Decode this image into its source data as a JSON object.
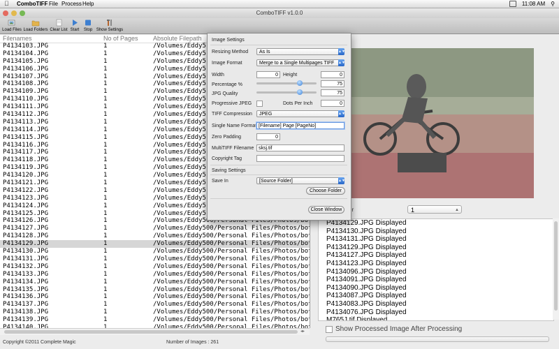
{
  "menubar": {
    "app_name": "ComboTIFF",
    "menus": [
      "File",
      "Process",
      "Help"
    ],
    "clock": "11:08 AM"
  },
  "window": {
    "title": "ComboTIFF v1.0.0"
  },
  "toolbar": {
    "load_files": "Load Files",
    "load_folders": "Load Folders",
    "clear_list": "Clear List",
    "start": "Start",
    "stop": "Stop",
    "show_settings": "Show Settings"
  },
  "table": {
    "headers": [
      "Filenames",
      "No of Pages",
      "Absolute Filepath"
    ],
    "rows": [
      [
        "P4134103.JPG",
        "1",
        "/Volumes/Eddy5"
      ],
      [
        "P4134104.JPG",
        "1",
        "/Volumes/Eddy5"
      ],
      [
        "P4134105.JPG",
        "1",
        "/Volumes/Eddy5"
      ],
      [
        "P4134106.JPG",
        "1",
        "/Volumes/Eddy5"
      ],
      [
        "P4134107.JPG",
        "1",
        "/Volumes/Eddy5"
      ],
      [
        "P4134108.JPG",
        "1",
        "/Volumes/Eddy5"
      ],
      [
        "P4134109.JPG",
        "1",
        "/Volumes/Eddy5"
      ],
      [
        "P4134110.JPG",
        "1",
        "/Volumes/Eddy5"
      ],
      [
        "P4134111.JPG",
        "1",
        "/Volumes/Eddy5"
      ],
      [
        "P4134112.JPG",
        "1",
        "/Volumes/Eddy5"
      ],
      [
        "P4134113.JPG",
        "1",
        "/Volumes/Eddy5"
      ],
      [
        "P4134114.JPG",
        "1",
        "/Volumes/Eddy5"
      ],
      [
        "P4134115.JPG",
        "1",
        "/Volumes/Eddy5"
      ],
      [
        "P4134116.JPG",
        "1",
        "/Volumes/Eddy5"
      ],
      [
        "P4134117.JPG",
        "1",
        "/Volumes/Eddy5"
      ],
      [
        "P4134118.JPG",
        "1",
        "/Volumes/Eddy5"
      ],
      [
        "P4134119.JPG",
        "1",
        "/Volumes/Eddy5"
      ],
      [
        "P4134120.JPG",
        "1",
        "/Volumes/Eddy5"
      ],
      [
        "P4134121.JPG",
        "1",
        "/Volumes/Eddy5"
      ],
      [
        "P4134122.JPG",
        "1",
        "/Volumes/Eddy5"
      ],
      [
        "P4134123.JPG",
        "1",
        "/Volumes/Eddy5"
      ],
      [
        "P4134124.JPG",
        "1",
        "/Volumes/Eddy5"
      ],
      [
        "P4134125.JPG",
        "1",
        "/Volumes/Eddy5"
      ],
      [
        "P4134126.JPG",
        "1",
        "/Volumes/Eddy500/Personal Files/Photos/botar"
      ],
      [
        "P4134127.JPG",
        "1",
        "/Volumes/Eddy500/Personal Files/Photos/botar"
      ],
      [
        "P4134128.JPG",
        "1",
        "/Volumes/Eddy500/Personal Files/Photos/botar"
      ],
      [
        "P4134129.JPG",
        "1",
        "/Volumes/Eddy500/Personal Files/Photos/botar"
      ],
      [
        "P4134130.JPG",
        "1",
        "/Volumes/Eddy500/Personal Files/Photos/botar"
      ],
      [
        "P4134131.JPG",
        "1",
        "/Volumes/Eddy500/Personal Files/Photos/botar"
      ],
      [
        "P4134132.JPG",
        "1",
        "/Volumes/Eddy500/Personal Files/Photos/botar"
      ],
      [
        "P4134133.JPG",
        "1",
        "/Volumes/Eddy500/Personal Files/Photos/botar"
      ],
      [
        "P4134134.JPG",
        "1",
        "/Volumes/Eddy500/Personal Files/Photos/botar"
      ],
      [
        "P4134135.JPG",
        "1",
        "/Volumes/Eddy500/Personal Files/Photos/botar"
      ],
      [
        "P4134136.JPG",
        "1",
        "/Volumes/Eddy500/Personal Files/Photos/botar"
      ],
      [
        "P4134137.JPG",
        "1",
        "/Volumes/Eddy500/Personal Files/Photos/botar"
      ],
      [
        "P4134138.JPG",
        "1",
        "/Volumes/Eddy500/Personal Files/Photos/botar"
      ],
      [
        "P4134139.JPG",
        "1",
        "/Volumes/Eddy500/Personal Files/Photos/botar"
      ],
      [
        "P4134140.JPG",
        "1",
        "/Volumes/Eddy500/Personal Files/Photos/botar"
      ]
    ],
    "selected_row": 26
  },
  "settings_panel": {
    "title": "Image Settings",
    "resizing_method_label": "Resizing Method",
    "resizing_method_value": "As Is",
    "image_format_label": "Image Format",
    "image_format_value": "Merge to a Single Multipages TIFF",
    "width_label": "Width",
    "width_value": "0",
    "height_label": "Height",
    "height_value": "0",
    "percentage_label": "Percentage %",
    "percentage_value": "75",
    "jpg_quality_label": "JPG Quality",
    "jpg_quality_value": "75",
    "progressive_jpeg_label": "Progressive JPEG",
    "dots_per_inch_label": "Dots Per Inch",
    "dots_per_inch_value": "0",
    "tiff_compression_label": "TIFF Compression",
    "tiff_compression_value": "JPEG",
    "single_name_format_label": "Single Name Format",
    "single_name_format_value": "[Filename] Page [PageNo]",
    "zero_padding_label": "Zero Padding",
    "zero_padding_value": "0",
    "multitiff_filename_label": "MultiTIFF Filename",
    "multitiff_filename_value": "sksj.tif",
    "copyright_tag_label": "Copyright Tag",
    "copyright_tag_value": "",
    "saving_settings_title": "Saving Settings",
    "save_in_label": "Save In",
    "save_in_value": "[Source Folder]",
    "choose_folder_button": "Choose Folder",
    "close_window_button": "Close Window"
  },
  "right_pane": {
    "partial_label": "er",
    "page_selector_value": "1",
    "log_lines": [
      "P4134129.JPG Displayed",
      "P4134130.JPG Displayed",
      "P4134131.JPG Displayed",
      "P4134129.JPG Displayed",
      "P4134127.JPG Displayed",
      "P4134123.JPG Displayed",
      "P4134096.JPG Displayed",
      "P4134091.JPG Displayed",
      "P4134090.JPG Displayed",
      "P4134087.JPG Displayed",
      "P4134083.JPG Displayed",
      "P4134076.JPG Displayed",
      "M765J.tif Displayed"
    ],
    "show_processed_label": "Show Processed Image After Processing"
  },
  "status": {
    "copyright": "Copyright ©2011 Complete Magic",
    "image_count": "Number of Images : 261"
  },
  "icons": {
    "menubar_apple": "apple-icon",
    "load_files": "image-stack-icon",
    "load_folders": "folder-icon",
    "clear_list": "document-icon",
    "start": "play-icon",
    "stop": "stop-icon",
    "show_settings": "tools-icon"
  }
}
